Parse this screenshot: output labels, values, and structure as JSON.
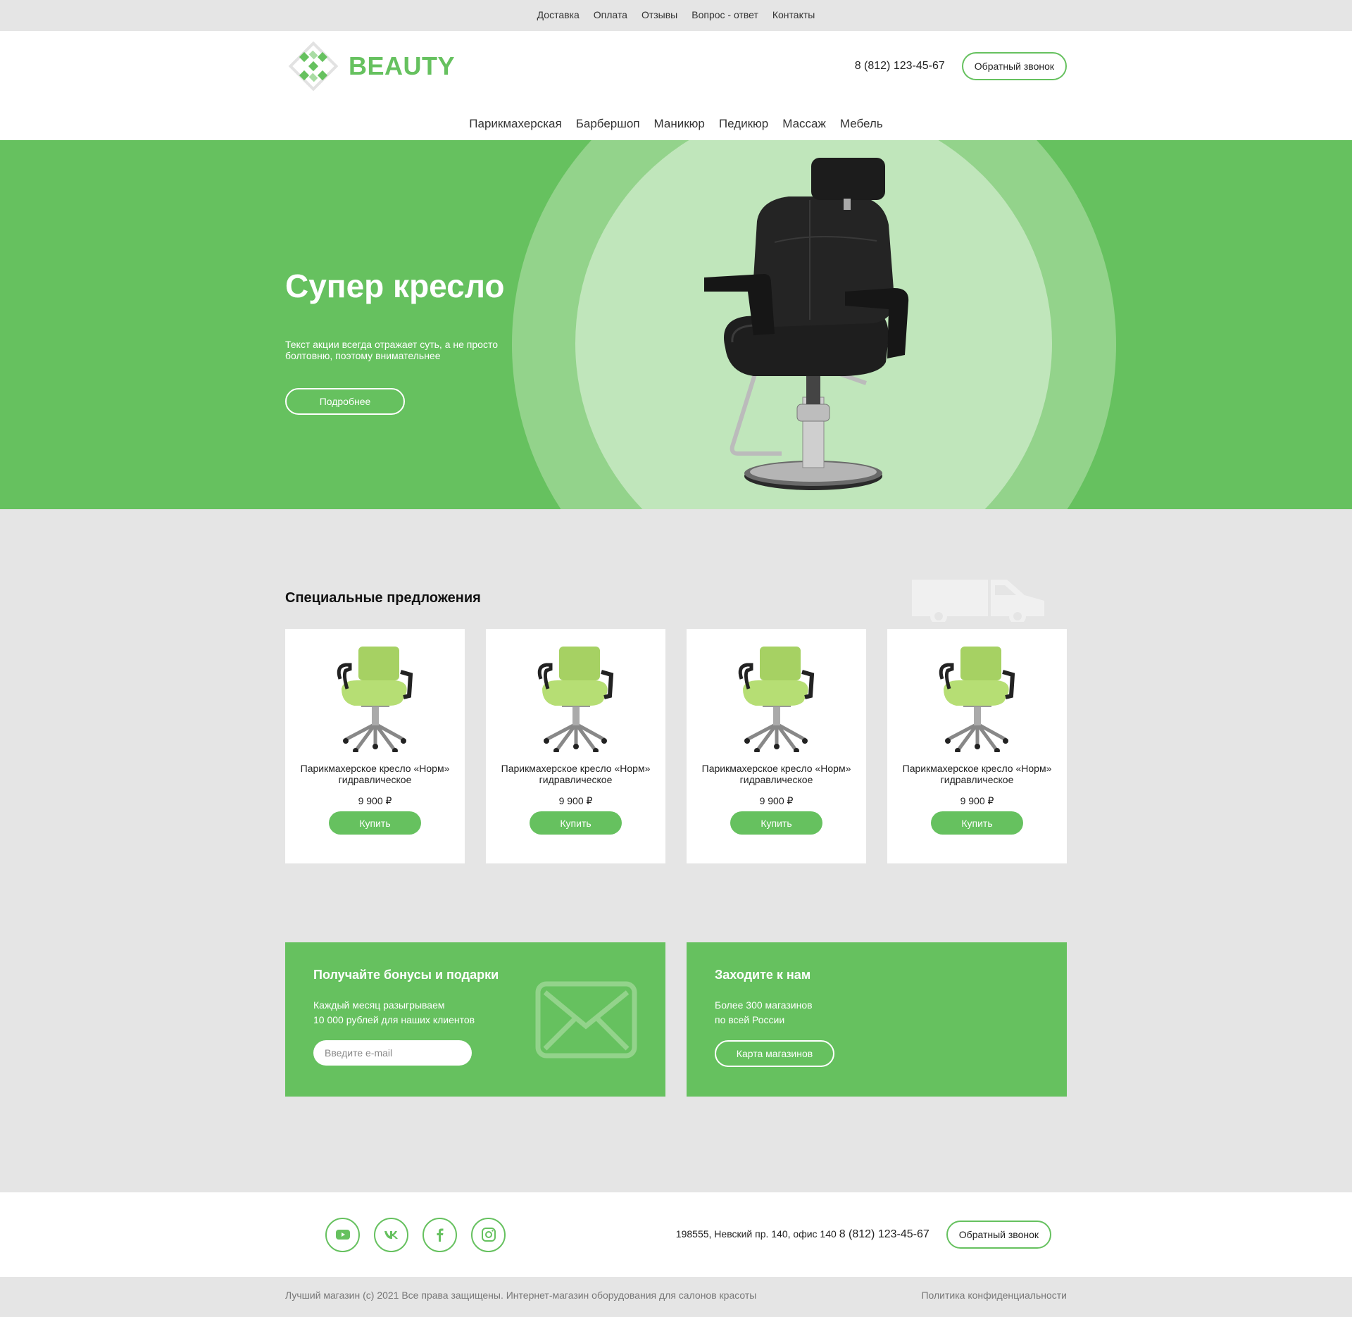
{
  "topnav": [
    "Доставка",
    "Оплата",
    "Отзывы",
    "Вопрос - ответ",
    "Контакты"
  ],
  "header": {
    "logo_text": "BEAUTY",
    "phone": "8 (812) 123-45-67",
    "callback_label": "Обратный звонок"
  },
  "mainnav": [
    "Парикмахерская",
    "Барбершоп",
    "Маникюр",
    "Педикюр",
    "Массаж",
    "Мебель"
  ],
  "hero": {
    "title": "Супер кресло",
    "text": "Текст акции всегда отражает суть, а не просто болтовню, поэтому внимательнее",
    "button": "Подробнее"
  },
  "specials": {
    "title": "Специальные предложения",
    "products": [
      {
        "title": "Парикмахерское кресло «Норм» гидравлическое",
        "price": "9 900 ₽",
        "button": "Купить"
      },
      {
        "title": "Парикмахерское кресло «Норм» гидравлическое",
        "price": "9 900 ₽",
        "button": "Купить"
      },
      {
        "title": "Парикмахерское кресло «Норм» гидравлическое",
        "price": "9 900 ₽",
        "button": "Купить"
      },
      {
        "title": "Парикмахерское кресло «Норм» гидравлическое",
        "price": "9 900 ₽",
        "button": "Купить"
      }
    ]
  },
  "promo_bonus": {
    "title": "Получайте бонусы и подарки",
    "line1": "Каждый месяц разыгрываем",
    "line2": "10 000 рублей для наших клиентов",
    "email_placeholder": "Введите e-mail"
  },
  "promo_stores": {
    "title": "Заходите к нам",
    "line1": "Более 300 магазинов",
    "line2": "по всей России",
    "button": "Карта магазинов"
  },
  "footer": {
    "address": "198555, Невский пр. 140, офис 140",
    "phone": "8 (812) 123-45-67",
    "callback_label": "Обратный звонок",
    "socials": [
      "youtube-icon",
      "vk-icon",
      "facebook-icon",
      "instagram-icon"
    ]
  },
  "bottom": {
    "copyright": "Лучший магазин (c) 2021 Все права защищены. Интернет-магазин оборудования для салонов красоты",
    "policy": "Политика конфиденциальности"
  },
  "colors": {
    "accent": "#66c15f",
    "hero_ring": "#93d38b",
    "hero_circle": "#c0e6bb",
    "background": "#e5e5e5"
  }
}
